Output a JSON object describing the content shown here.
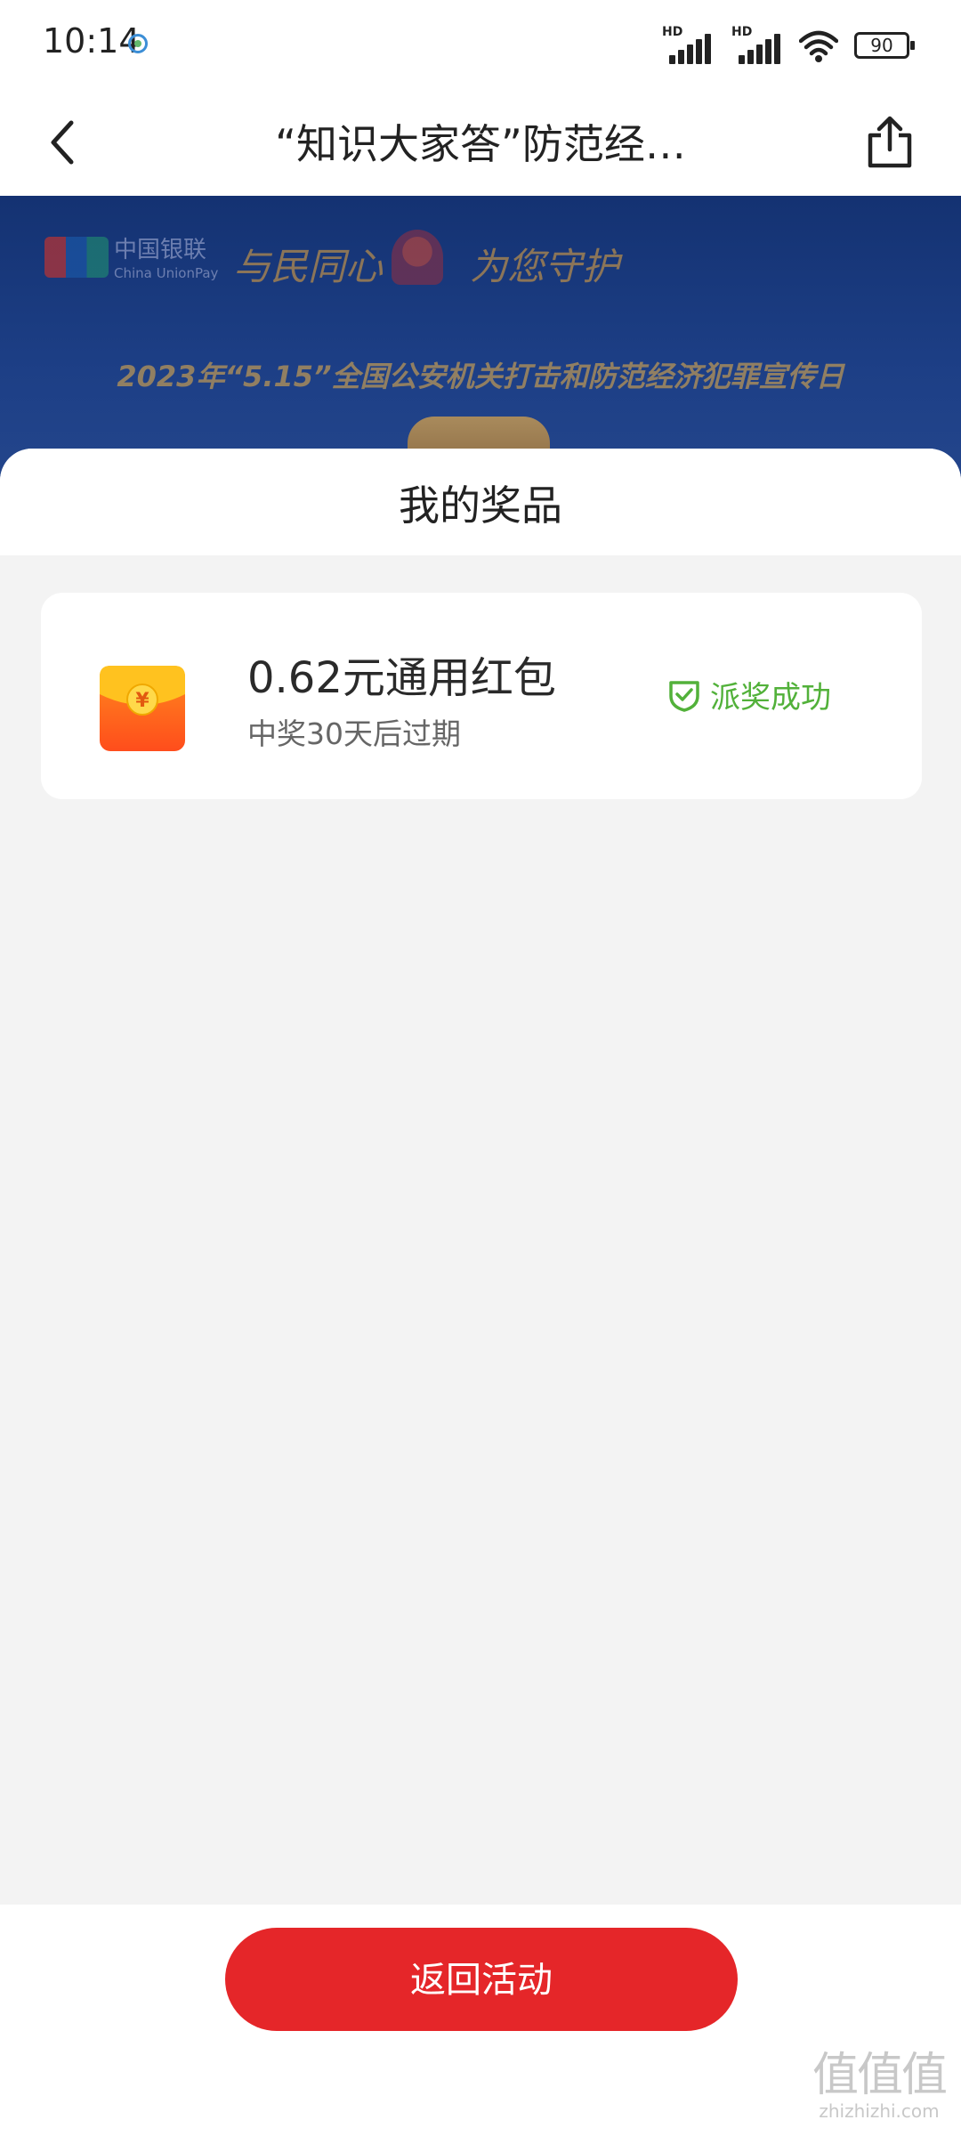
{
  "status_bar": {
    "time": "10:14",
    "network_1": "HD",
    "network_2": "HD",
    "battery": "90",
    "icons": [
      "carrier-icon",
      "signal-icon",
      "signal-icon",
      "wifi-icon",
      "battery-icon"
    ]
  },
  "nav": {
    "title": "“知识大家答”防范经…",
    "back_icon": "chevron-left-icon",
    "share_icon": "share-icon"
  },
  "banner": {
    "logo_text": "中国银联",
    "logo_sub": "China UnionPay",
    "slogan_left": "与民同心",
    "slogan_right": "为您守护",
    "headline": "2023年“5.15”全国公安机关打击和防范经济犯罪宣传日"
  },
  "prizes": {
    "title": "我的奖品",
    "items": [
      {
        "name": "0.62元通用红包",
        "expiry": "中奖30天后过期",
        "status": "派奖成功",
        "icon": "red-envelope-icon",
        "status_icon": "shield-check-icon"
      }
    ]
  },
  "footer": {
    "button_label": "返回活动"
  },
  "watermark": {
    "mark": "值值值",
    "domain": "zhizhizhi.com"
  },
  "colors": {
    "accent_red": "#e52629",
    "success_green": "#52b13a",
    "banner_blue": "#1d3f86",
    "page_bg": "#f3f3f3"
  }
}
